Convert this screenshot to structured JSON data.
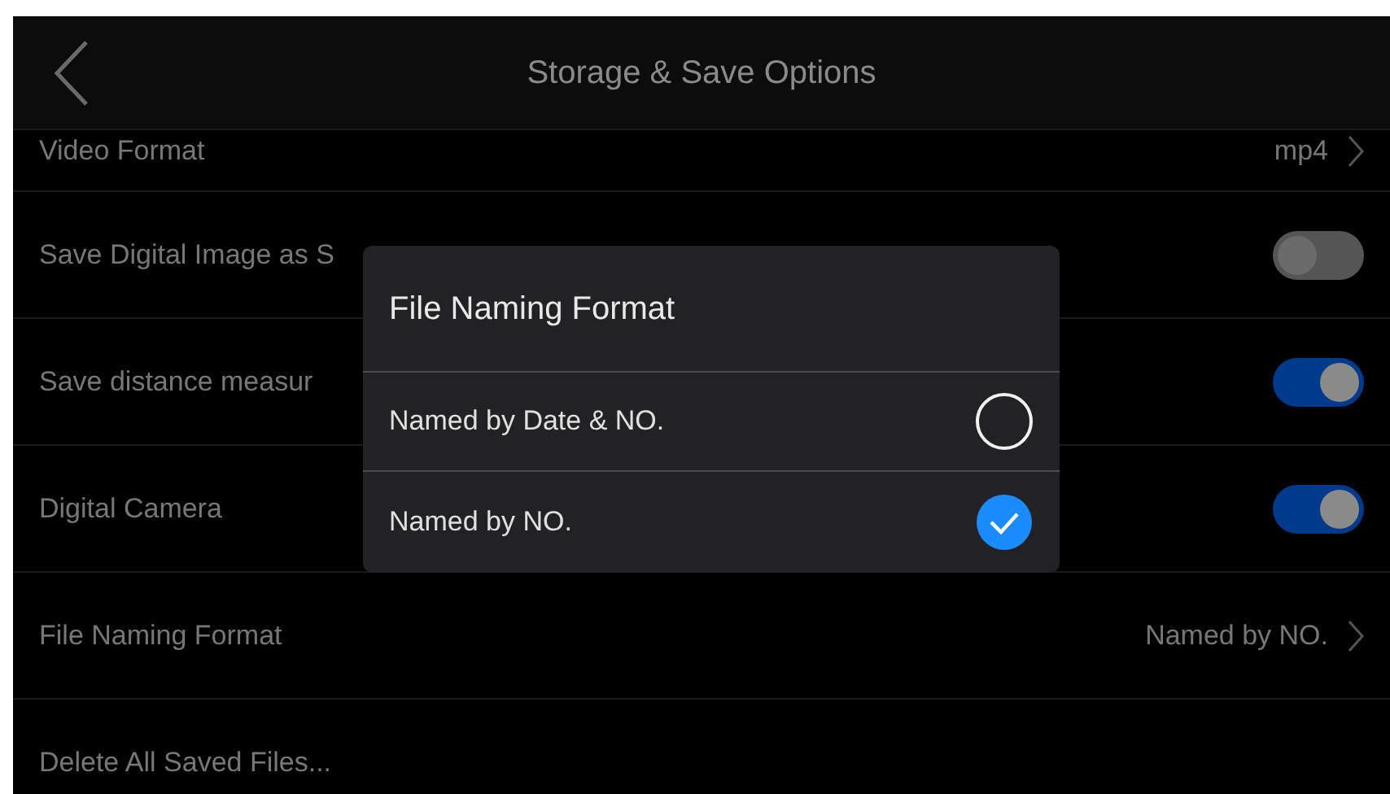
{
  "header": {
    "title": "Storage & Save Options"
  },
  "rows": [
    {
      "kind": "value",
      "label": "Video Format",
      "value": "mp4"
    },
    {
      "kind": "toggle",
      "label": "Save Digital Image as S",
      "on": false
    },
    {
      "kind": "toggle",
      "label": "Save distance measur",
      "on": true
    },
    {
      "kind": "toggle",
      "label": "Digital Camera",
      "on": true
    },
    {
      "kind": "value",
      "label": "File Naming Format",
      "value": "Named by NO."
    },
    {
      "kind": "plain",
      "label": "Delete All Saved Files..."
    }
  ],
  "dialog": {
    "title": "File Naming Format",
    "options": [
      {
        "label": "Named by Date & NO.",
        "selected": false
      },
      {
        "label": "Named by NO.",
        "selected": true
      }
    ]
  }
}
